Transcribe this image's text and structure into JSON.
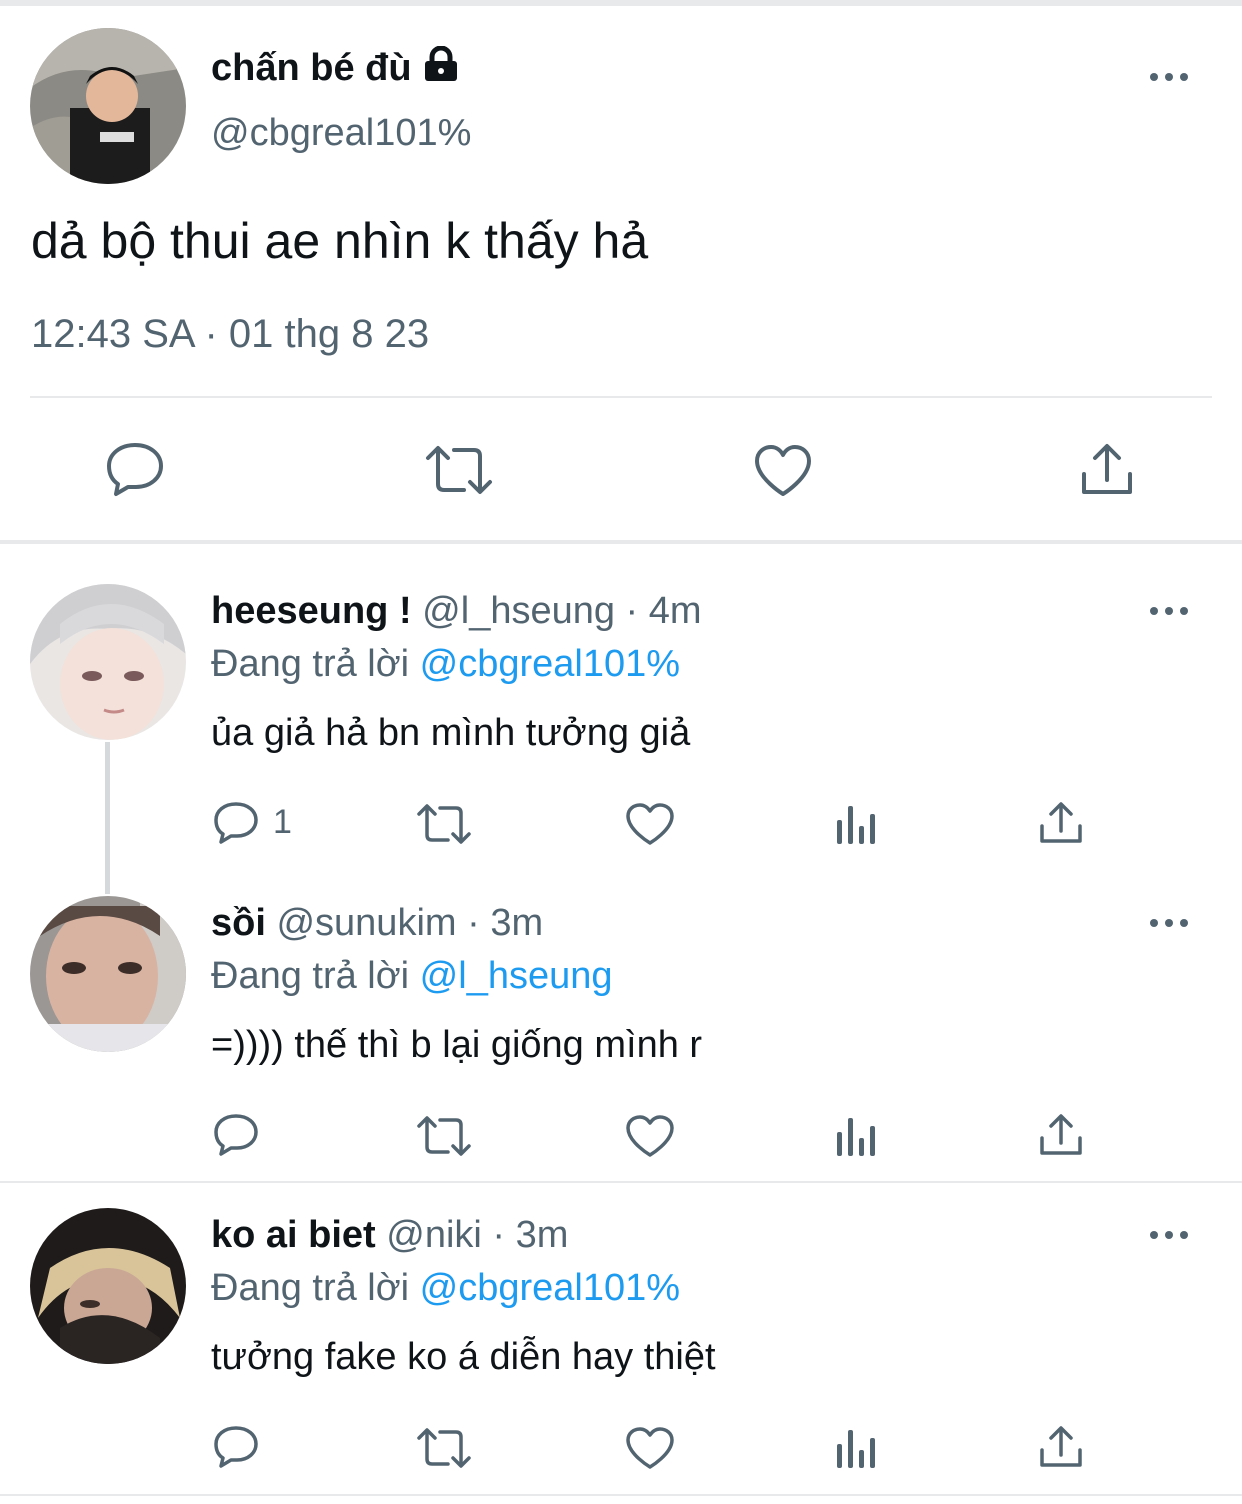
{
  "main_tweet": {
    "display_name": "chấn bé đù",
    "handle": "@cbgreal101%",
    "text": "dả bộ thui ae nhìn k thấy hả",
    "timestamp": "12:43 SA · 01 thg 8 23",
    "icons": [
      "lock-icon",
      "more-icon",
      "reply-icon",
      "retweet-icon",
      "like-icon",
      "share-icon"
    ]
  },
  "replies": [
    {
      "display_name": "heeseung !",
      "handle": "@l_hseung",
      "time": "4m",
      "reply_prefix": "Đang trả lời",
      "reply_to": "@cbgreal101%",
      "text": "ủa giả hả bn mình tưởng giả",
      "reply_count": "1"
    },
    {
      "display_name": "sồi",
      "handle": "@sunukim",
      "time": "3m",
      "reply_prefix": "Đang trả lời",
      "reply_to": "@l_hseung",
      "text": "=)))) thế thì b lại giống mình r",
      "reply_count": ""
    },
    {
      "display_name": "ko ai biet",
      "handle": "@niki",
      "time": "3m",
      "reply_prefix": "Đang trả lời",
      "reply_to": "@cbgreal101%",
      "text": "tưởng fake ko á diễn hay thiệt",
      "reply_count": ""
    }
  ],
  "colors": {
    "accent": "#1d9bf0",
    "secondary_text": "#536471",
    "divider": "#e7e9eb"
  }
}
